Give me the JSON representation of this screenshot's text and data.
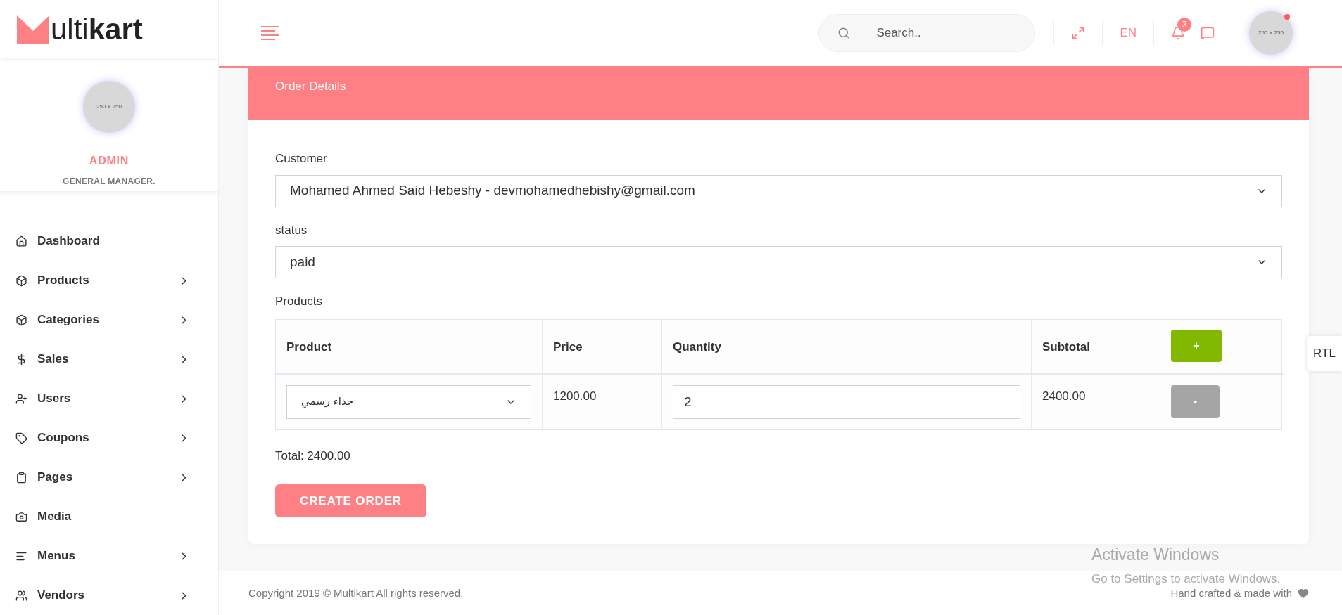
{
  "logo": {
    "text": "ulti**kart**"
  },
  "profile": {
    "avatar_text": "250 × 250",
    "name": "ADMIN",
    "role": "GENERAL MANAGER."
  },
  "sidebar": {
    "items": [
      {
        "label": "Dashboard",
        "expandable": false
      },
      {
        "label": "Products",
        "expandable": true
      },
      {
        "label": "Categories",
        "expandable": true
      },
      {
        "label": "Sales",
        "expandable": true
      },
      {
        "label": "Users",
        "expandable": true
      },
      {
        "label": "Coupons",
        "expandable": true
      },
      {
        "label": "Pages",
        "expandable": true
      },
      {
        "label": "Media",
        "expandable": false
      },
      {
        "label": "Menus",
        "expandable": true
      },
      {
        "label": "Vendors",
        "expandable": true
      }
    ]
  },
  "header": {
    "search": {
      "placeholder": "Search.."
    },
    "language": "EN",
    "notification_count": "3",
    "avatar_text": "250 × 250",
    "online": true
  },
  "card": {
    "title": "Order Details",
    "customer": {
      "label": "Customer",
      "value": "Mohamed Ahmed Said Hebeshy - devmohamedhebishy@gmail.com"
    },
    "status": {
      "label": "status",
      "value": "paid"
    },
    "products_label": "Products",
    "table": {
      "columns": [
        "Product",
        "Price",
        "Quantity",
        "Subtotal"
      ],
      "add_button": "+",
      "rows": [
        {
          "product": "حذاء رسمي",
          "price": "1200.00",
          "quantity": "2",
          "subtotal": "2400.00",
          "remove_button": "-"
        }
      ]
    },
    "total": "Total: 2400.00",
    "submit": "CREATE ORDER"
  },
  "rtl_button": "RTL",
  "footer": {
    "copyright": "Copyright 2019 © Multikart All rights reserved.",
    "credit": "Hand crafted & made with"
  },
  "os_notice": {
    "title": "Activate Windows",
    "text": "Go to Settings to activate Windows."
  }
}
